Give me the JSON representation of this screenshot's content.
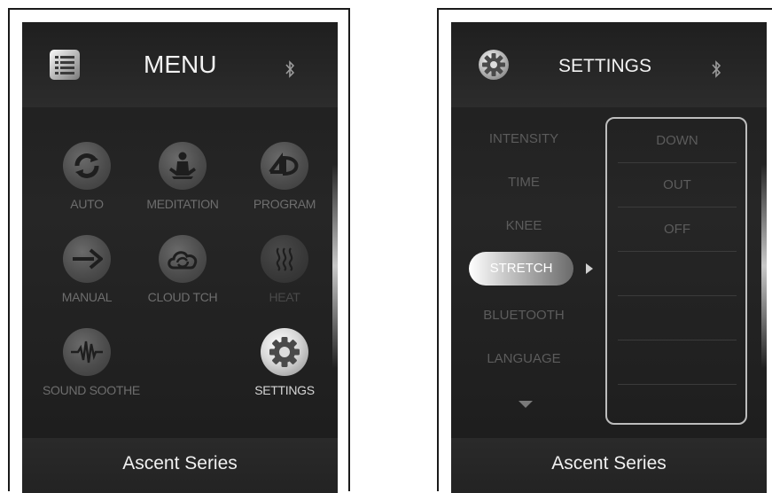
{
  "left_panel": {
    "header": {
      "title": "MENU",
      "icon": "list-icon",
      "bluetooth_icon": "bluetooth-icon"
    },
    "items": [
      {
        "label": "AUTO",
        "icon": "refresh-cycle-icon",
        "state": "normal"
      },
      {
        "label": "MEDITATION",
        "icon": "meditation-icon",
        "state": "normal"
      },
      {
        "label": "PROGRAM",
        "icon": "4d-icon",
        "state": "normal"
      },
      {
        "label": "MANUAL",
        "icon": "arrow-right-icon",
        "state": "normal"
      },
      {
        "label": "CLOUD TCH",
        "icon": "cloud-sync-icon",
        "state": "normal"
      },
      {
        "label": "HEAT",
        "icon": "heat-icon",
        "state": "dim"
      },
      {
        "label": "SOUND SOOTHE",
        "icon": "sound-wave-icon",
        "state": "normal"
      },
      {
        "label": "SETTINGS",
        "icon": "gear-icon",
        "state": "active"
      }
    ],
    "footer": {
      "text": "Ascent Series"
    }
  },
  "right_panel": {
    "header": {
      "title": "SETTINGS",
      "icon": "gear-icon",
      "bluetooth_icon": "bluetooth-icon"
    },
    "settings": [
      "INTENSITY",
      "TIME",
      "KNEE",
      "STRETCH",
      "BLUETOOTH",
      "LANGUAGE"
    ],
    "selected_setting": "STRETCH",
    "options": [
      "DOWN",
      "OUT",
      "OFF",
      "",
      "",
      "",
      ""
    ],
    "footer": {
      "text": "Ascent Series"
    }
  }
}
